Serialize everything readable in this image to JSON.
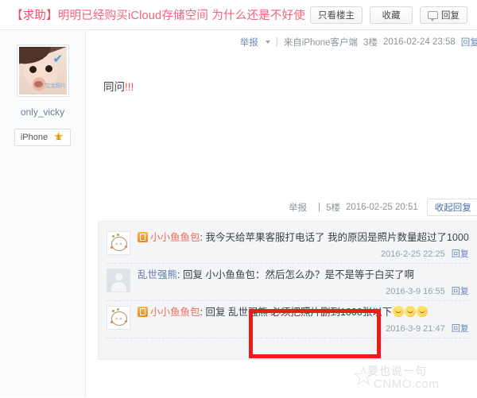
{
  "thread": {
    "title_tag": "【求助】",
    "title_text": "明明已经购买iCloud存储空间 为什么还是不好使",
    "title_color": "#f2647a"
  },
  "title_actions": [
    {
      "label": "只看楼主",
      "icon": ""
    },
    {
      "label": "收藏",
      "icon": ""
    },
    {
      "label": "回复",
      "icon": "reply-bubble-icon"
    }
  ],
  "author": {
    "username": "only_vicky",
    "device_badge": "iPhone",
    "level": "1",
    "avatar_watermark": "宝宝照片"
  },
  "post": {
    "meta": {
      "report": "举报",
      "separator": "|",
      "source": "来自iPhone客户端",
      "floor": "3楼",
      "time": "2016-02-24 23:58",
      "reply_link": "回复"
    },
    "content_text": "同问",
    "content_excl": "!!!"
  },
  "subreply_header": {
    "report": "举报",
    "separator": "|",
    "floor": "5楼",
    "time": "2016-02-25 20:51",
    "collapse_label": "收起回复"
  },
  "subreplies": [
    {
      "avatar_type": "cartoon",
      "has_badge": true,
      "username": "小小鱼鱼包",
      "username_color": "#e8705a",
      "colon": ":",
      "reply_word": "",
      "quoted_user": "",
      "body": "我今天给苹果客服打电话了 我的原因是照片数量超过了1000",
      "emoji_count": 0,
      "time": "2016-2-25 22:25",
      "reply_link": "回复"
    },
    {
      "avatar_type": "silhouette",
      "has_badge": false,
      "username": "乱世强熊",
      "username_color": "#5f7ba8",
      "colon": ":",
      "reply_word": "回复",
      "quoted_user": "小小鱼鱼包",
      "body": "：然后怎么办？是不是等于白买了啊",
      "emoji_count": 0,
      "time": "2016-3-9 16:55",
      "reply_link": "回复"
    },
    {
      "avatar_type": "cartoon",
      "has_badge": true,
      "username": "小小鱼鱼包",
      "username_color": "#e8705a",
      "colon": ":",
      "reply_word": "回复",
      "quoted_user": "乱世强熊",
      "body": "必须把照片删到1000张以下",
      "emoji_count": 3,
      "time": "2016-3-9 21:47",
      "reply_link": "回复"
    }
  ],
  "annotation": {
    "box_color": "#ee1c18",
    "highlights": "必须把照片删到1000张以下"
  },
  "watermark": {
    "star_glyph": "☆",
    "cn_text": "要也说一句",
    "domain": "CNMO.com"
  }
}
